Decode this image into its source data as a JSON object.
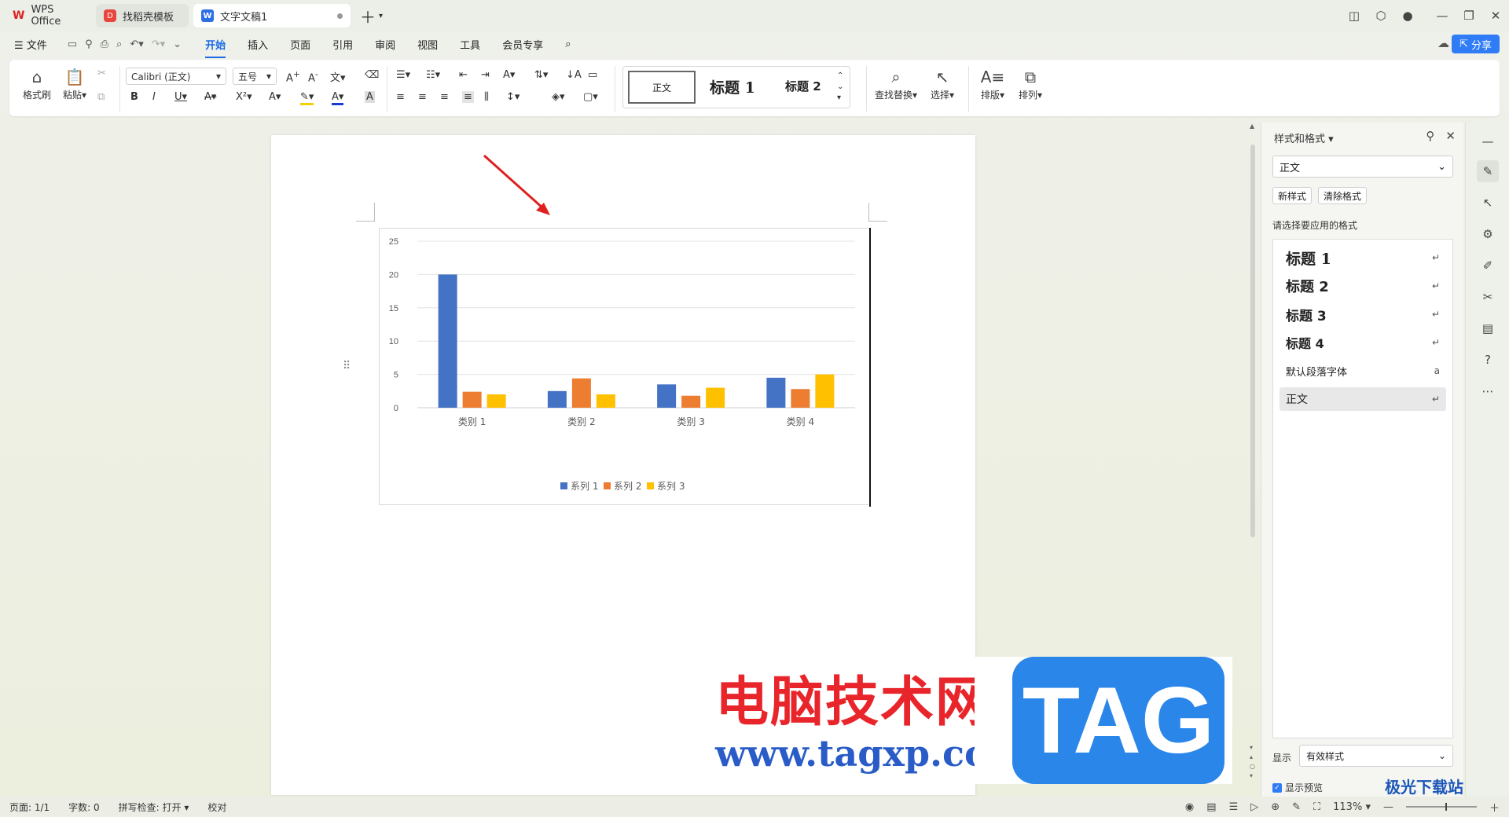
{
  "tabs": [
    {
      "label": "WPS Office"
    },
    {
      "label": "找稻壳模板"
    },
    {
      "label": "文字文稿1"
    }
  ],
  "menu": {
    "file": "文件",
    "items": [
      "开始",
      "插入",
      "页面",
      "引用",
      "审阅",
      "视图",
      "工具",
      "会员专享"
    ],
    "active": "开始",
    "share": "分享"
  },
  "ribbon": {
    "format_painter": "格式刷",
    "paste": "粘贴",
    "font": "Calibri (正文)",
    "font_size": "五号",
    "styles": {
      "normal": "正文",
      "h1": "标题 1",
      "h2": "标题 2"
    },
    "find_replace": "查找替换",
    "select": "选择",
    "layout": "排版",
    "arrange": "排列"
  },
  "chart_data": {
    "type": "bar",
    "categories": [
      "类别 1",
      "类别 2",
      "类别 3",
      "类别 4"
    ],
    "series": [
      {
        "name": "系列 1",
        "color": "#4472C4",
        "values": [
          20,
          2.5,
          3.5,
          4.5
        ]
      },
      {
        "name": "系列 2",
        "color": "#ED7D31",
        "values": [
          2.4,
          4.4,
          1.8,
          2.8
        ]
      },
      {
        "name": "系列 3",
        "color": "#FFC000",
        "values": [
          2,
          2,
          3,
          5
        ]
      }
    ],
    "yticks": [
      0,
      5,
      10,
      15,
      20,
      25
    ],
    "ylim": [
      0,
      25
    ],
    "legend": "bottom",
    "grid": true
  },
  "panel": {
    "title": "样式和格式",
    "current_style": "正文",
    "new_style": "新样式",
    "clear_format": "清除格式",
    "hint": "请选择要应用的格式",
    "styles": [
      {
        "label": "标题 1",
        "kind": "h"
      },
      {
        "label": "标题 2",
        "kind": "h"
      },
      {
        "label": "标题 3",
        "kind": "h"
      },
      {
        "label": "标题 4",
        "kind": "h"
      },
      {
        "label": "默认段落字体",
        "kind": "char"
      },
      {
        "label": "正文",
        "kind": "p"
      }
    ],
    "show_label": "显示",
    "show_value": "有效样式",
    "preview": "显示预览"
  },
  "status": {
    "page": "页面: 1/1",
    "words": "字数: 0",
    "spell": "拼写检查: 打开",
    "proof": "校对",
    "zoom": "113%"
  },
  "watermark": {
    "site_name": "电脑技术网",
    "url": "www.tagxp.com",
    "tag": "TAG",
    "corner": "极光下载站"
  }
}
